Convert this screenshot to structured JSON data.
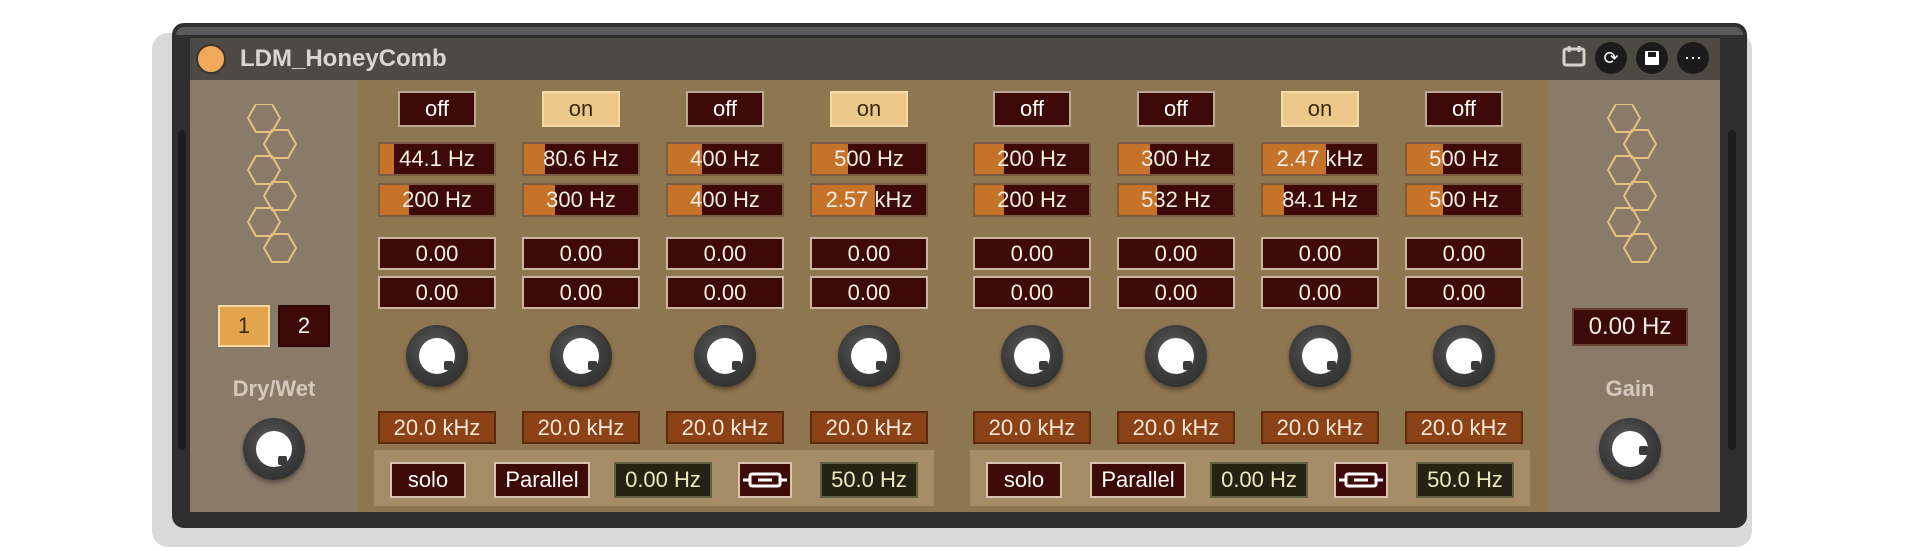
{
  "device": {
    "title": "LDM_HoneyComb",
    "header_icons": [
      "calendar-icon",
      "refresh-icon",
      "save-icon",
      "more-icon"
    ]
  },
  "left": {
    "banks": [
      "1",
      "2"
    ],
    "selected_bank": "1",
    "drywet_label": "Dry/Wet"
  },
  "right": {
    "freq_readout": "0.00 Hz",
    "gain_label": "Gain"
  },
  "bands": [
    {
      "toggle": "off",
      "freq_low": "44.1 Hz",
      "freq_low_fill": 0.12,
      "freq_high": "200 Hz",
      "freq_high_fill": 0.25,
      "val1": "0.00",
      "val2": "0.00",
      "cutoff": "20.0 kHz"
    },
    {
      "toggle": "on",
      "freq_low": "80.6 Hz",
      "freq_low_fill": 0.18,
      "freq_high": "300 Hz",
      "freq_high_fill": 0.27,
      "val1": "0.00",
      "val2": "0.00",
      "cutoff": "20.0 kHz"
    },
    {
      "toggle": "off",
      "freq_low": "400 Hz",
      "freq_low_fill": 0.3,
      "freq_high": "400 Hz",
      "freq_high_fill": 0.3,
      "val1": "0.00",
      "val2": "0.00",
      "cutoff": "20.0 kHz"
    },
    {
      "toggle": "on",
      "freq_low": "500 Hz",
      "freq_low_fill": 0.32,
      "freq_high": "2.57 kHz",
      "freq_high_fill": 0.55,
      "val1": "0.00",
      "val2": "0.00",
      "cutoff": "20.0 kHz"
    },
    {
      "toggle": "off",
      "freq_low": "200 Hz",
      "freq_low_fill": 0.25,
      "freq_high": "200 Hz",
      "freq_high_fill": 0.25,
      "val1": "0.00",
      "val2": "0.00",
      "cutoff": "20.0 kHz"
    },
    {
      "toggle": "off",
      "freq_low": "300 Hz",
      "freq_low_fill": 0.27,
      "freq_high": "532 Hz",
      "freq_high_fill": 0.33,
      "val1": "0.00",
      "val2": "0.00",
      "cutoff": "20.0 kHz"
    },
    {
      "toggle": "on",
      "freq_low": "2.47 kHz",
      "freq_low_fill": 0.55,
      "freq_high": "84.1 Hz",
      "freq_high_fill": 0.18,
      "val1": "0.00",
      "val2": "0.00",
      "cutoff": "20.0 kHz"
    },
    {
      "toggle": "off",
      "freq_low": "500 Hz",
      "freq_low_fill": 0.32,
      "freq_high": "500 Hz",
      "freq_high_fill": 0.32,
      "val1": "0.00",
      "val2": "0.00",
      "cutoff": "20.0 kHz"
    }
  ],
  "groups": [
    {
      "solo": "solo",
      "mode": "Parallel",
      "freq": "0.00 Hz",
      "link_icon": "link-icon",
      "freq2": "50.0 Hz"
    },
    {
      "solo": "solo",
      "mode": "Parallel",
      "freq": "0.00 Hz",
      "link_icon": "link-icon",
      "freq2": "50.0 Hz"
    }
  ],
  "colors": {
    "background_center": "#8e7650",
    "background_side": "#8a7b69",
    "toggle_on": "#ecc98a",
    "toggle_off": "#3e0a07",
    "freq_fill": "#c6732a",
    "cutoff_box": "#8c4217",
    "honeycomb_stroke": "#e8c27a"
  }
}
